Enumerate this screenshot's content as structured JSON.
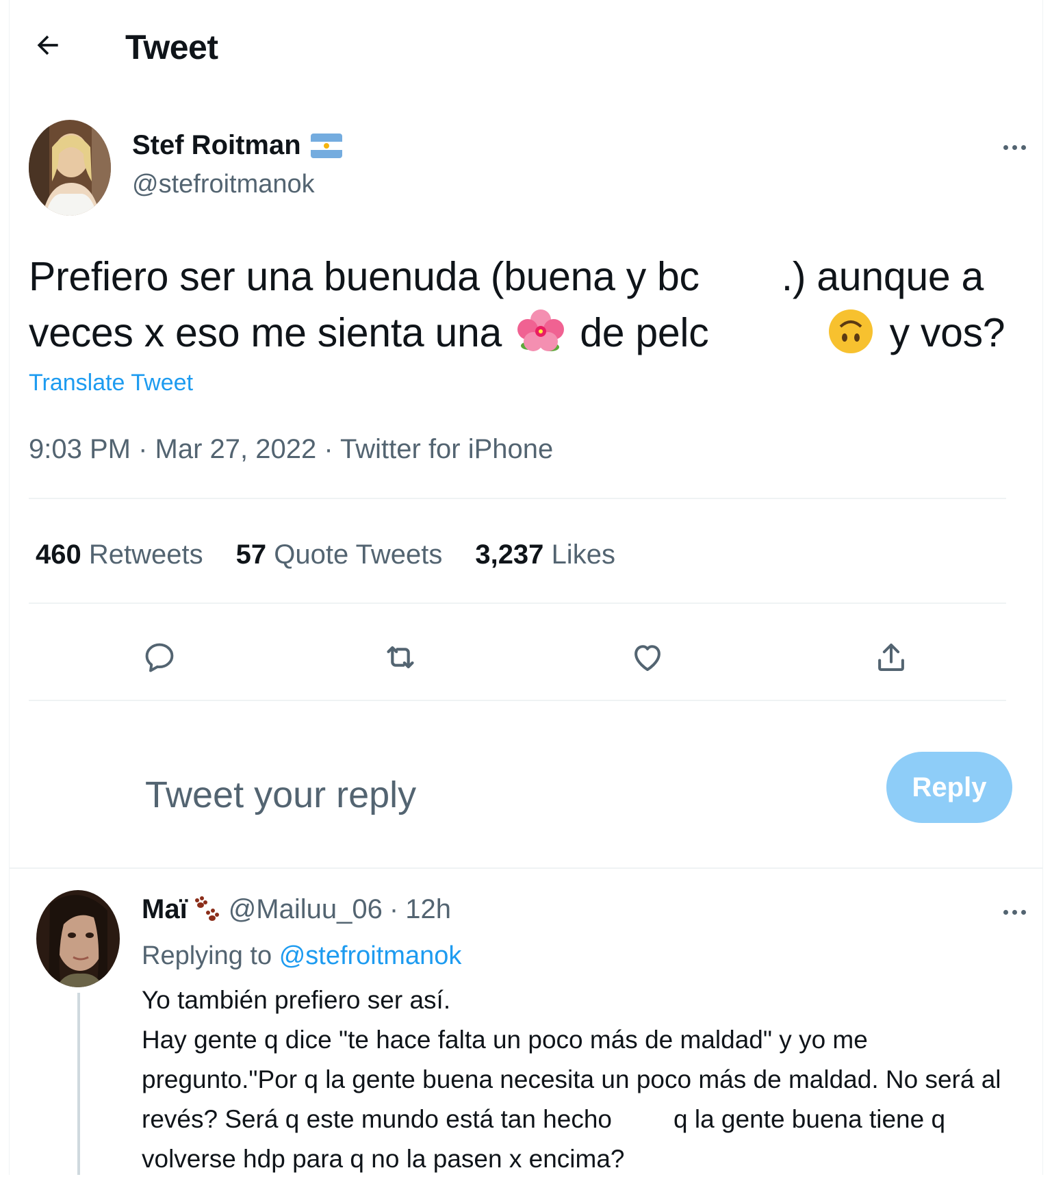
{
  "header": {
    "title": "Tweet"
  },
  "tweet": {
    "author_name": "Stef Roitman",
    "author_handle": "@stefroitmanok",
    "text_line1_a": "Prefiero ser una buenuda (buena y bc",
    "text_line1_b": ".) aunque a",
    "text_line2_a": "veces x eso me sienta una",
    "text_line2_b": "de pelc",
    "text_line2_c": "y vos?",
    "translate_label": "Translate Tweet",
    "meta": "9:03 PM · Mar 27, 2022 · Twitter for iPhone",
    "stats": [
      {
        "num": "460",
        "label": "Retweets"
      },
      {
        "num": "57",
        "label": "Quote Tweets"
      },
      {
        "num": "3,237",
        "label": "Likes"
      }
    ]
  },
  "reply_box": {
    "placeholder": "Tweet your reply",
    "button_label": "Reply"
  },
  "reply": {
    "name": "Maï",
    "handle": "@Mailuu_06",
    "sep": "·",
    "time": "12h",
    "replying_prefix": "Replying to",
    "replying_handle": "@stefroitmanok",
    "lines": [
      "Yo también prefiero ser así.",
      "Hay gente q dice \"te hace falta un poco más de maldad\" y yo me",
      "pregunto.\"Por q la gente buena necesita un poco más de maldad. No será al",
      "revés? Será q este mundo está tan hecho",
      "q la gente buena tiene q",
      "volverse hdp para q no la pasen x encima?"
    ]
  },
  "colors": {
    "accent": "#1d9bf0",
    "reply_button": "#8ecdf8",
    "muted": "#536471",
    "text": "#0f1419",
    "divider": "#eff3f4"
  },
  "icons": [
    "back-arrow-icon",
    "argentina-flag-icon",
    "more-icon",
    "hibiscus-emoji-icon",
    "upside-down-face-emoji-icon",
    "reply-icon",
    "retweet-icon",
    "like-icon",
    "share-icon",
    "paw-prints-emoji-icon"
  ]
}
